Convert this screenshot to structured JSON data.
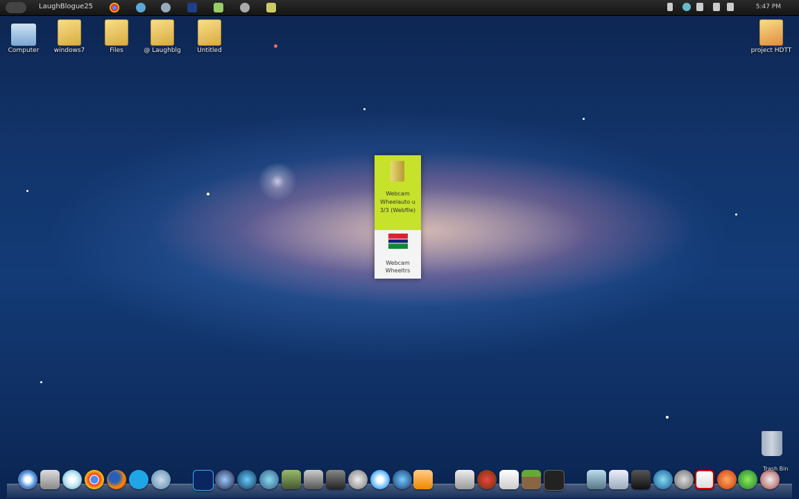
{
  "menubar": {
    "app_title": "LaughBlogue25",
    "clock": "5:47 PM",
    "icons": [
      "chrome-icon",
      "network-icon",
      "settings-icon",
      "photoshop-icon",
      "folder-icon",
      "gear-icon",
      "notes-icon"
    ],
    "status_icons": [
      "wifi-icon",
      "signal-icon",
      "volume-icon",
      "battery-icon"
    ]
  },
  "desktop": {
    "icons": [
      {
        "name": "computer-icon",
        "label": "Computer"
      },
      {
        "name": "folder-icon",
        "label": "windows7"
      },
      {
        "name": "folder-icon",
        "label": "Files"
      },
      {
        "name": "folder-icon",
        "label": "@ Laughblg"
      },
      {
        "name": "folder-icon",
        "label": "Untitled"
      },
      {
        "name": "folder-icon",
        "label": "project HDTT"
      }
    ]
  },
  "popup": {
    "item1_label": "Webcam Wheelauto u 3/3 (Webfile)",
    "item2_label": "Webcam Wheeltrs"
  },
  "dock": {
    "trash_label": "Trash Bin",
    "icons": [
      "safari-icon",
      "photos-icon",
      "dvd-icon",
      "chrome-icon",
      "firefox-icon",
      "skype-icon",
      "network-icon",
      "photoshop-icon",
      "globe-icon",
      "mail-icon",
      "image-icon",
      "video-icon",
      "audio-icon",
      "film-icon",
      "settings-icon",
      "safari-icon",
      "media-player-icon",
      "counterstrike-icon",
      "media-icon",
      "document-icon",
      "minecraft-icon",
      "terminal-icon",
      "screen-icon",
      "calendar-icon",
      "blackberry-icon",
      "globe-icon",
      "app-icon",
      "adobe-icon",
      "speed-icon",
      "utorrent-icon",
      "app-icon"
    ]
  }
}
